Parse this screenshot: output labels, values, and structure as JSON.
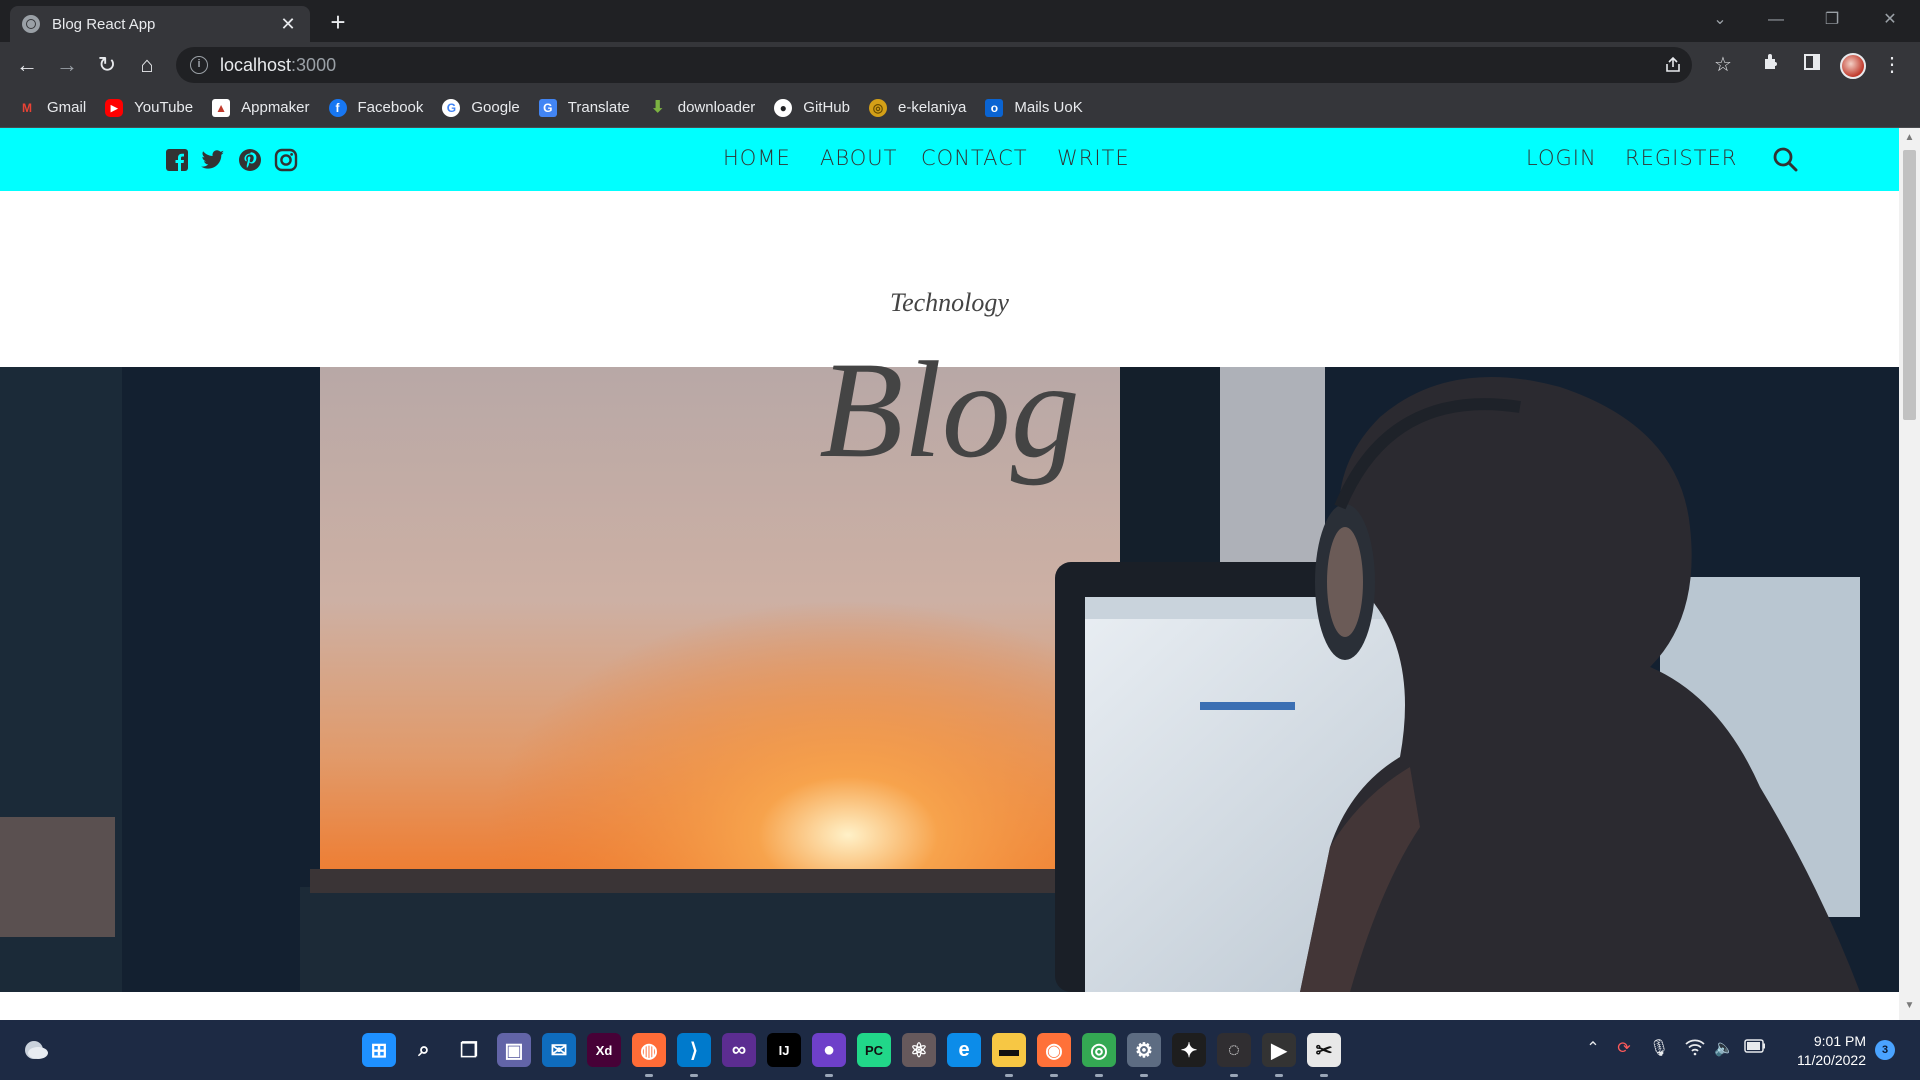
{
  "browser": {
    "tab_title": "Blog React App",
    "tab_close": "✕",
    "new_tab": "+",
    "url_host": "localhost",
    "url_port": ":3000",
    "window_controls": {
      "chevron": "⌄",
      "minimize": "—",
      "restore": "❐",
      "close": "✕"
    },
    "nav": {
      "back": "←",
      "forward": "→",
      "reload": "↻",
      "home": "⌂"
    }
  },
  "bookmarks": [
    {
      "label": "Gmail",
      "icon": "gmail-icon",
      "color": "#ea4335",
      "glyph": "M"
    },
    {
      "label": "YouTube",
      "icon": "youtube-icon",
      "color": "#ff0000",
      "glyph": "▶"
    },
    {
      "label": "Appmaker",
      "icon": "appmaker-icon",
      "color": "#c0392b",
      "glyph": "▲"
    },
    {
      "label": "Facebook",
      "icon": "facebook-icon",
      "color": "#1877f2",
      "glyph": "f"
    },
    {
      "label": "Google",
      "icon": "google-icon",
      "color": "#ffffff",
      "glyph": "G"
    },
    {
      "label": "Translate",
      "icon": "translate-icon",
      "color": "#4285f4",
      "glyph": "G"
    },
    {
      "label": "downloader",
      "icon": "download-icon",
      "color": "#7cb342",
      "glyph": "⬇"
    },
    {
      "label": "GitHub",
      "icon": "github-icon",
      "color": "#ffffff",
      "glyph": "●"
    },
    {
      "label": "e-kelaniya",
      "icon": "ekelaniya-icon",
      "color": "#d4a017",
      "glyph": "◎"
    },
    {
      "label": "Mails UoK",
      "icon": "outlook-icon",
      "color": "#0a64d2",
      "glyph": "o"
    }
  ],
  "site": {
    "nav_links": [
      "HOME",
      "ABOUT",
      "CONTACT",
      "WRITE"
    ],
    "auth_links": [
      "LOGIN",
      "REGISTER"
    ],
    "header_subtitle": "Technology",
    "header_title": "Blog",
    "accent_color": "#00ffff"
  },
  "taskbar": {
    "time": "9:01 PM",
    "date": "11/20/2022",
    "notification_count": "3",
    "apps": [
      {
        "name": "start-icon",
        "color": "#1e90ff",
        "glyph": "⊞",
        "active": false
      },
      {
        "name": "search-icon",
        "color": "transparent",
        "glyph": "⌕",
        "active": false
      },
      {
        "name": "task-view-icon",
        "color": "transparent",
        "glyph": "❐",
        "active": false
      },
      {
        "name": "teams-chat-icon",
        "color": "#6264a7",
        "glyph": "▣",
        "active": false
      },
      {
        "name": "mail-icon",
        "color": "#0f6cbd",
        "glyph": "✉",
        "active": false
      },
      {
        "name": "adobe-xd-icon",
        "color": "#470137",
        "glyph": "Xd",
        "active": false
      },
      {
        "name": "postman-icon",
        "color": "#ff6c37",
        "glyph": "◍",
        "active": true
      },
      {
        "name": "vscode-icon",
        "color": "#007acc",
        "glyph": "⟩",
        "active": true
      },
      {
        "name": "visual-studio-icon",
        "color": "#5c2d91",
        "glyph": "∞",
        "active": false
      },
      {
        "name": "intellij-icon",
        "color": "#000000",
        "glyph": "IJ",
        "active": false
      },
      {
        "name": "github-desktop-icon",
        "color": "#6e40c9",
        "glyph": "●",
        "active": true
      },
      {
        "name": "pycharm-icon",
        "color": "#21d789",
        "glyph": "PC",
        "active": false
      },
      {
        "name": "atom-icon",
        "color": "#66595c",
        "glyph": "⚛",
        "active": false
      },
      {
        "name": "edge-icon",
        "color": "#0c8ce9",
        "glyph": "e",
        "active": false
      },
      {
        "name": "file-explorer-icon",
        "color": "#f7c744",
        "glyph": "▬",
        "active": true
      },
      {
        "name": "firefox-icon",
        "color": "#ff7139",
        "glyph": "◉",
        "active": true
      },
      {
        "name": "chrome-icon",
        "color": "#34a853",
        "glyph": "◎",
        "active": true
      },
      {
        "name": "settings-icon",
        "color": "#5d6c82",
        "glyph": "⚙",
        "active": true
      },
      {
        "name": "figma-icon",
        "color": "#1e1e1e",
        "glyph": "✦",
        "active": false
      },
      {
        "name": "obs-icon",
        "color": "#302e31",
        "glyph": "◌",
        "active": true
      },
      {
        "name": "media-player-icon",
        "color": "#333333",
        "glyph": "▶",
        "active": true
      },
      {
        "name": "snipping-tool-icon",
        "color": "#e8e8e8",
        "glyph": "✂",
        "active": true
      }
    ]
  }
}
